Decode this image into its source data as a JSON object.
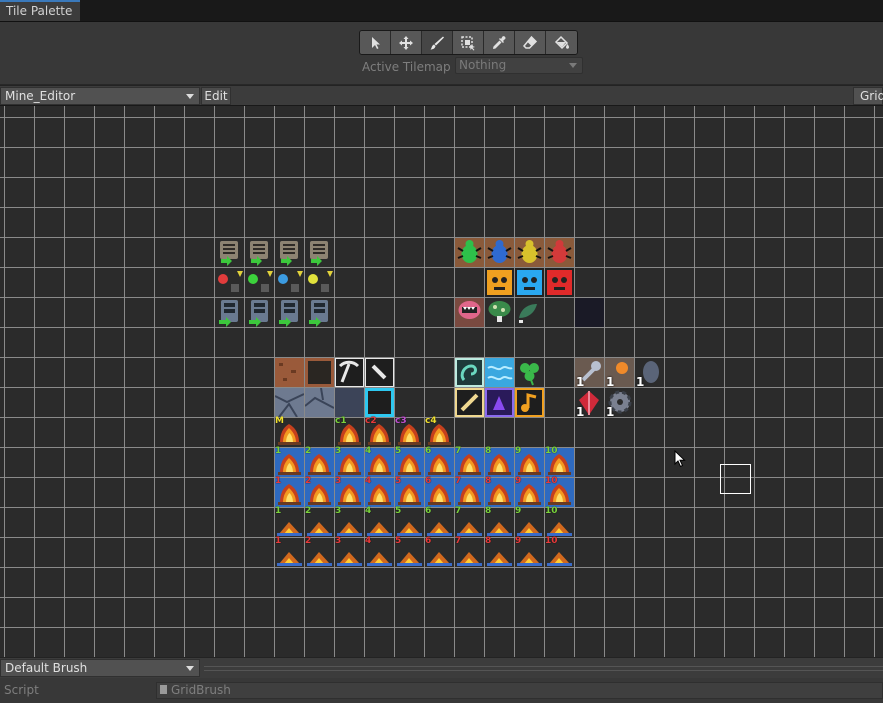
{
  "window": {
    "tab_title": "Tile Palette"
  },
  "toolbar": {
    "tools": [
      {
        "icon": "select-arrow-icon",
        "active": false
      },
      {
        "icon": "move-icon",
        "active": false
      },
      {
        "icon": "paint-brush-icon",
        "active": true
      },
      {
        "icon": "box-fill-icon",
        "active": false
      },
      {
        "icon": "eyedropper-icon",
        "active": false
      },
      {
        "icon": "eraser-icon",
        "active": false
      },
      {
        "icon": "paint-bucket-icon",
        "active": false
      }
    ],
    "active_tilemap_label": "Active Tilemap",
    "active_tilemap_value": "Nothing"
  },
  "palette_bar": {
    "palette_name": "Mine_Editor",
    "edit_label": "Edit",
    "grid_label": "Grid"
  },
  "footer": {
    "brush_name": "Default Brush",
    "script_label": "Script",
    "script_value": "GridBrush"
  },
  "colors": {
    "accent": "#3a79bb",
    "panel": "#383838",
    "canvas": "#2b2b2b",
    "grid_line": "#8a8a8a"
  },
  "tiles": {
    "row_numbers": [
      "1",
      "2",
      "3",
      "4",
      "5",
      "6",
      "7",
      "8",
      "9",
      "10"
    ],
    "tile_labels": [
      "M",
      "c1",
      "c2",
      "c3",
      "c4"
    ],
    "resource_counts": [
      "1",
      "1",
      "1",
      "1",
      "1"
    ]
  }
}
